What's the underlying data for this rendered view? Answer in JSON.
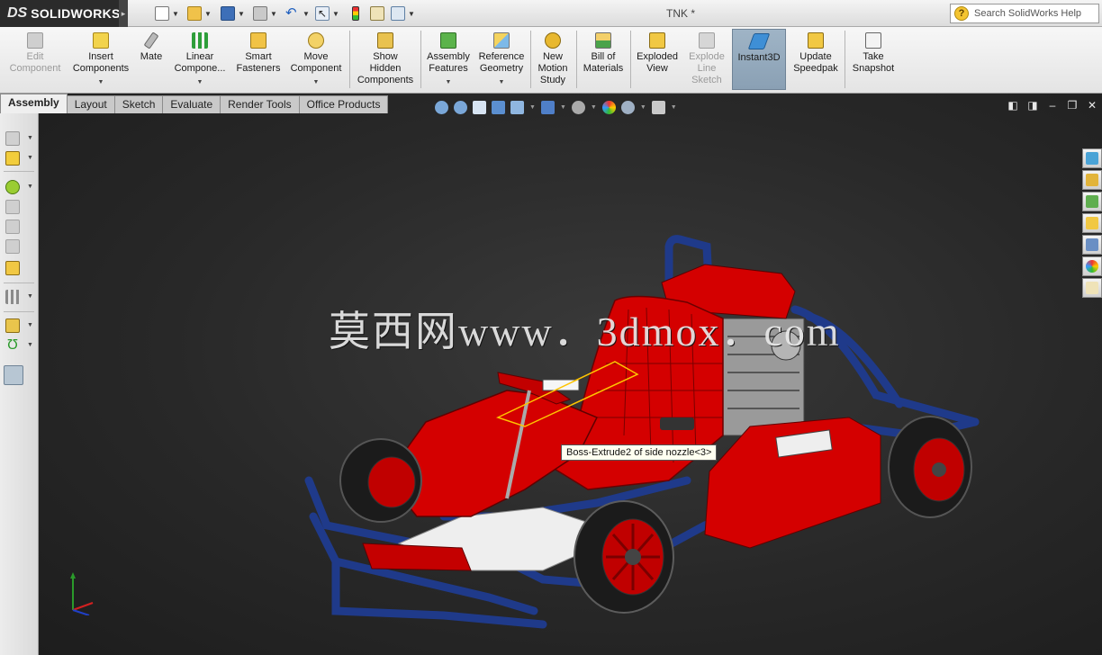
{
  "app": {
    "logo_prefix": "DS",
    "logo_name": "SOLIDWORKS",
    "doc_title": "TNK *"
  },
  "help_search": {
    "placeholder": "Search SolidWorks Help"
  },
  "quick_access": [
    "new-doc-icon",
    "open-icon",
    "save-icon",
    "print-icon",
    "undo-icon",
    "select-icon",
    "rebuild-icon",
    "file-props-icon",
    "options-icon"
  ],
  "commands": [
    {
      "label1": "Edit",
      "label2": "Component",
      "label3": "",
      "disabled": true,
      "icon": "edit-component-icon"
    },
    {
      "label1": "Insert",
      "label2": "Components",
      "label3": "",
      "disabled": false,
      "icon": "insert-components-icon"
    },
    {
      "label1": "Mate",
      "label2": "",
      "label3": "",
      "disabled": false,
      "icon": "mate-icon"
    },
    {
      "label1": "Linear",
      "label2": "Compone...",
      "label3": "",
      "disabled": false,
      "icon": "linear-pattern-icon"
    },
    {
      "label1": "Smart",
      "label2": "Fasteners",
      "label3": "",
      "disabled": false,
      "icon": "smart-fasteners-icon"
    },
    {
      "label1": "Move",
      "label2": "Component",
      "label3": "",
      "disabled": false,
      "icon": "move-component-icon"
    },
    {
      "label1": "Show",
      "label2": "Hidden",
      "label3": "Components",
      "disabled": false,
      "icon": "show-hidden-icon"
    },
    {
      "label1": "Assembly",
      "label2": "Features",
      "label3": "",
      "disabled": false,
      "icon": "assembly-features-icon"
    },
    {
      "label1": "Reference",
      "label2": "Geometry",
      "label3": "",
      "disabled": false,
      "icon": "reference-geometry-icon"
    },
    {
      "label1": "New",
      "label2": "Motion",
      "label3": "Study",
      "disabled": false,
      "icon": "motion-study-icon"
    },
    {
      "label1": "Bill of",
      "label2": "Materials",
      "label3": "",
      "disabled": false,
      "icon": "bom-icon"
    },
    {
      "label1": "Exploded",
      "label2": "View",
      "label3": "",
      "disabled": false,
      "icon": "exploded-view-icon"
    },
    {
      "label1": "Explode",
      "label2": "Line",
      "label3": "Sketch",
      "disabled": true,
      "icon": "explode-line-icon"
    },
    {
      "label1": "Instant3D",
      "label2": "",
      "label3": "",
      "disabled": false,
      "icon": "instant3d-icon"
    },
    {
      "label1": "Update",
      "label2": "Speedpak",
      "label3": "",
      "disabled": false,
      "icon": "speedpak-icon"
    },
    {
      "label1": "Take",
      "label2": "Snapshot",
      "label3": "",
      "disabled": false,
      "icon": "snapshot-icon"
    }
  ],
  "tabs": [
    "Assembly",
    "Layout",
    "Sketch",
    "Evaluate",
    "Render Tools",
    "Office Products"
  ],
  "active_tab": "Assembly",
  "viewport": {
    "watermark": "莫西网www．3dmox．com",
    "tooltip": "Boss-Extrude2 of side nozzle<3>"
  },
  "colors": {
    "accent_red": "#d40000",
    "frame_blue": "#1f3a8a",
    "viewport_bg": "#2a2a2a"
  }
}
